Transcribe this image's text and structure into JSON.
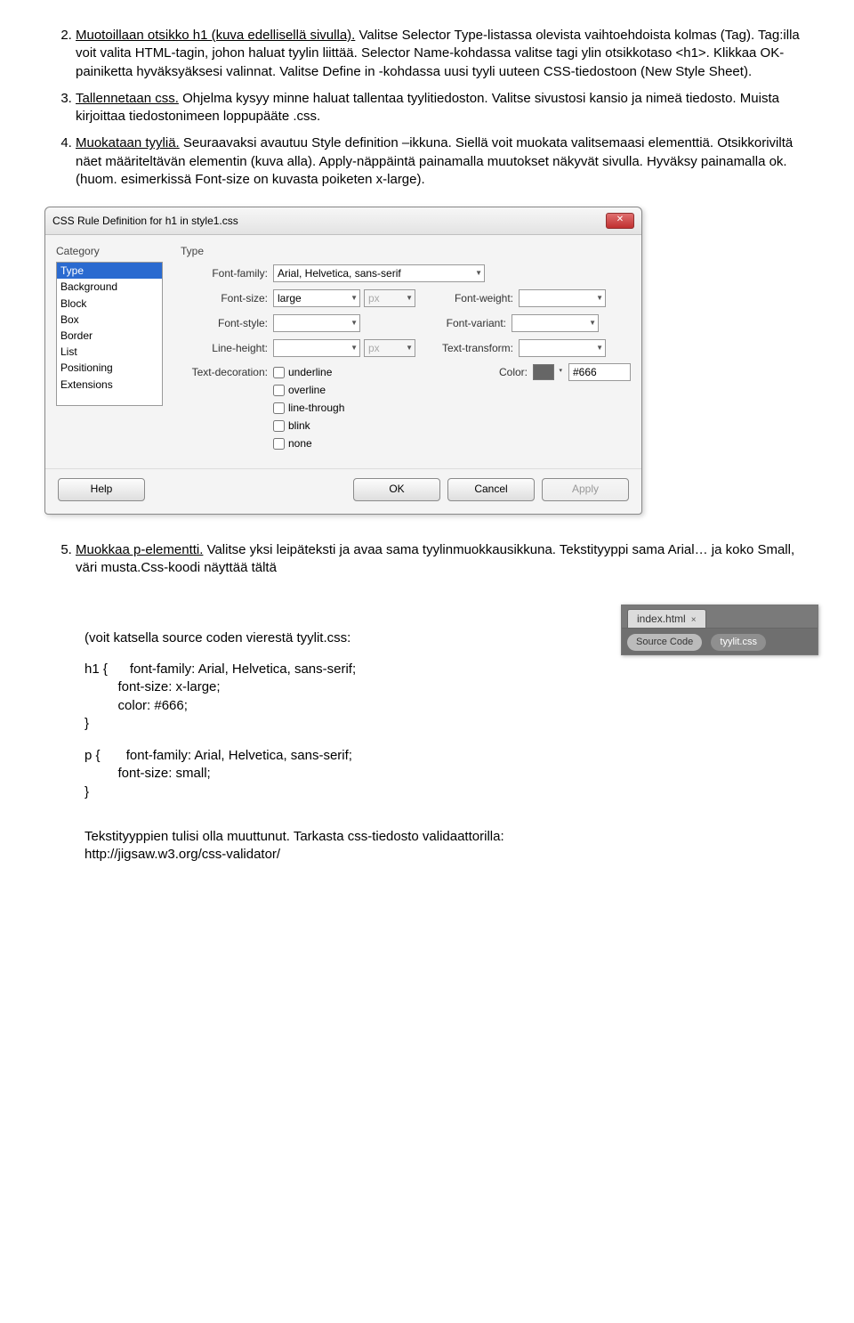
{
  "steps": {
    "s2": {
      "title": "Muotoillaan otsikko h1 (kuva edellisellä sivulla).",
      "body": " Valitse Selector Type-listassa olevista vaihtoehdoista kolmas (Tag). Tag:illa voit valita HTML-tagin, johon haluat tyylin liittää. Selector Name-kohdassa valitse tagi ylin otsikkotaso <h1>. Klikkaa OK-painiketta hyväksyäksesi valinnat. Valitse Define in -kohdassa uusi tyyli uuteen CSS-tiedostoon (New Style Sheet)."
    },
    "s3": {
      "title": "Tallennetaan css.",
      "body": " Ohjelma kysyy minne haluat tallentaa tyylitiedoston. Valitse sivustosi kansio ja nimeä tiedosto. Muista kirjoittaa tiedostonimeen loppupääte .css."
    },
    "s4": {
      "title": "Muokataan tyyliä.",
      "body": " Seuraavaksi avautuu Style definition –ikkuna. Siellä voit muokata valitsemaasi elementtiä. Otsikkoriviltä näet määriteltävän elementin (kuva alla). Apply-näppäintä painamalla muutokset näkyvät sivulla. Hyväksy painamalla ok. (huom. esimerkissä Font-size on kuvasta poiketen x-large)."
    },
    "s5": {
      "title": "Muokkaa p-elementti.",
      "body": " Valitse yksi leipäteksti ja avaa sama tyylinmuokkausikkuna. Tekstityyppi sama Arial… ja koko Small, väri musta.Css-koodi näyttää tältä"
    }
  },
  "dialog": {
    "title": "CSS Rule Definition for h1 in style1.css",
    "catlabel": "Category",
    "typelabel": "Type",
    "categories": [
      "Type",
      "Background",
      "Block",
      "Box",
      "Border",
      "List",
      "Positioning",
      "Extensions"
    ],
    "labels": {
      "fontfamily": "Font-family:",
      "fontsize": "Font-size:",
      "fontweight": "Font-weight:",
      "fontstyle": "Font-style:",
      "fontvariant": "Font-variant:",
      "lineheight": "Line-height:",
      "texttransform": "Text-transform:",
      "textdecoration": "Text-decoration:",
      "color": "Color:"
    },
    "values": {
      "fontfamily": "Arial, Helvetica, sans-serif",
      "fontsize": "large",
      "unit": "px",
      "colortext": "#666"
    },
    "decorations": [
      "underline",
      "overline",
      "line-through",
      "blink",
      "none"
    ],
    "buttons": {
      "help": "Help",
      "ok": "OK",
      "cancel": "Cancel",
      "apply": "Apply"
    }
  },
  "tabs": {
    "tab": "index.html",
    "source": "Source Code",
    "css": "tyylit.css"
  },
  "after5": {
    "line": "(voit katsella source coden vierestä tyylit.css:",
    "codeh1_open": "h1 {",
    "codeh1_l1": "font-family: Arial, Helvetica, sans-serif;",
    "codeh1_l2": "font-size: x-large;",
    "codeh1_l3": "color: #666;",
    "brace": "}",
    "codep_open": "p {",
    "codep_l1": "font-family: Arial, Helvetica, sans-serif;",
    "codep_l2": "font-size: small;",
    "footer1": "Tekstityyppien tulisi olla muuttunut. Tarkasta css-tiedosto validaattorilla:",
    "footer2": "http://jigsaw.w3.org/css-validator/"
  }
}
